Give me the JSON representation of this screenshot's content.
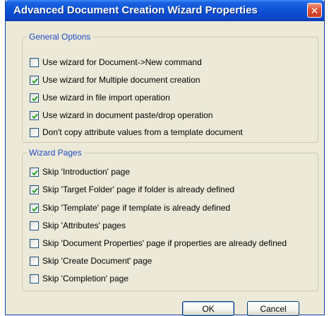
{
  "window": {
    "title": "Advanced Document Creation Wizard Properties"
  },
  "general": {
    "label": "General Options",
    "items": [
      {
        "label": "Use wizard for Document->New command",
        "checked": false
      },
      {
        "label": "Use wizard for Multiple document creation",
        "checked": true
      },
      {
        "label": "Use wizard in file import operation",
        "checked": true
      },
      {
        "label": "Use wizard in document paste/drop operation",
        "checked": true
      },
      {
        "label": "Don't copy attribute values from a template document",
        "checked": false
      }
    ]
  },
  "pages": {
    "label": "Wizard Pages",
    "items": [
      {
        "label": "Skip 'Introduction' page",
        "checked": true
      },
      {
        "label": "Skip 'Target Folder' page if folder is already defined",
        "checked": true
      },
      {
        "label": "Skip 'Template' page if template is already defined",
        "checked": true
      },
      {
        "label": "Skip 'Attributes' pages",
        "checked": false
      },
      {
        "label": "Skip 'Document Properties' page if properties are already defined",
        "checked": false
      },
      {
        "label": "Skip 'Create Document' page",
        "checked": false
      },
      {
        "label": "Skip 'Completion' page",
        "checked": false
      }
    ]
  },
  "buttons": {
    "ok": "OK",
    "cancel": "Cancel"
  },
  "colors": {
    "check": "#21a121",
    "group_label": "#1e4bc4"
  }
}
